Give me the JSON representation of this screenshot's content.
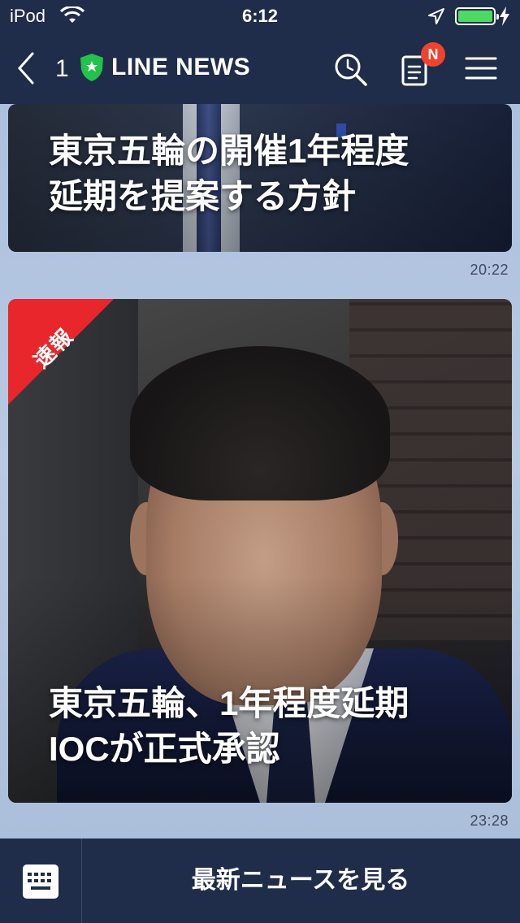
{
  "status_bar": {
    "carrier": "iPod",
    "time": "6:12",
    "battery_color": "#4cd964"
  },
  "nav": {
    "back_count": "1",
    "title": "LINE NEWS",
    "badge": "N",
    "logo_color": "#23c34b",
    "badge_color": "#f0432e"
  },
  "articles": [
    {
      "headline_line1": "東京五輪の開催1年程度",
      "headline_line2": "延期を提案する方針",
      "time": "20:22"
    },
    {
      "ribbon": "速報",
      "headline_line1": "東京五輪、1年程度延期",
      "headline_line2": "IOCが正式承認",
      "time": "23:28"
    }
  ],
  "bottom_bar": {
    "latest_label": "最新ニュースを見る"
  },
  "colors": {
    "bar_background": "#1f2d4a",
    "ribbon": "#e8262c"
  }
}
